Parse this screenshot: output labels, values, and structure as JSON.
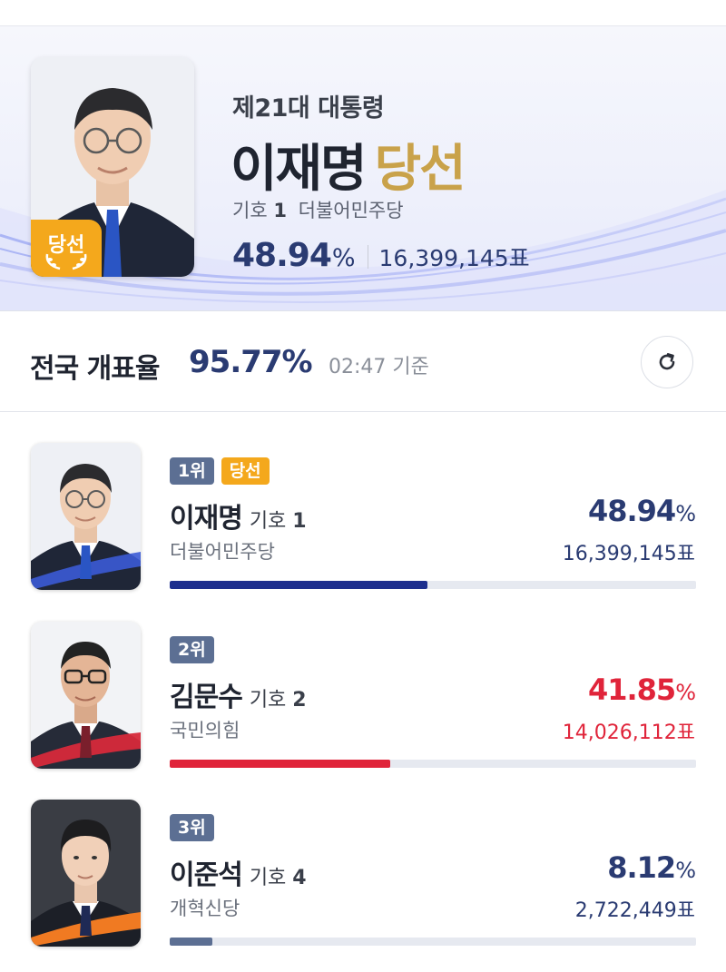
{
  "colors": {
    "accent_blue": "#2a3b72",
    "bar_blue": "#1d2f8e",
    "accent_red": "#e0243a",
    "winner_gold": "#c9a24a",
    "winner_badge": "#f4a81c",
    "rank_tag": "#5c6f93",
    "bar_gray": "#5c6f93"
  },
  "hero": {
    "election": "제21대 대통령",
    "name": "이재명",
    "result": "당선",
    "badge": "당선",
    "number_label": "기호",
    "number": "1",
    "party": "더불어민주당",
    "percent": "48.94",
    "percent_unit": "%",
    "votes": "16,399,145표"
  },
  "count": {
    "label": "전국 개표율",
    "rate": "95.77%",
    "time": "02:47 기준",
    "refresh_icon": "refresh-icon"
  },
  "candidates": [
    {
      "rank": "1위",
      "winner": "당선",
      "name": "이재명",
      "number_label": "기호",
      "number": "1",
      "party": "더불어민주당",
      "percent": "48.94",
      "percent_unit": "%",
      "votes": "16,399,145표",
      "share": 0.4894,
      "color": "#2a3b72",
      "bar_color": "#1d2f8e"
    },
    {
      "rank": "2위",
      "name": "김문수",
      "number_label": "기호",
      "number": "2",
      "party": "국민의힘",
      "percent": "41.85",
      "percent_unit": "%",
      "votes": "14,026,112표",
      "share": 0.4185,
      "color": "#e0243a",
      "bar_color": "#e0243a"
    },
    {
      "rank": "3위",
      "name": "이준석",
      "number_label": "기호",
      "number": "4",
      "party": "개혁신당",
      "percent": "8.12",
      "percent_unit": "%",
      "votes": "2,722,449표",
      "share": 0.0812,
      "color": "#2a3b72",
      "bar_color": "#5c6f93"
    }
  ]
}
